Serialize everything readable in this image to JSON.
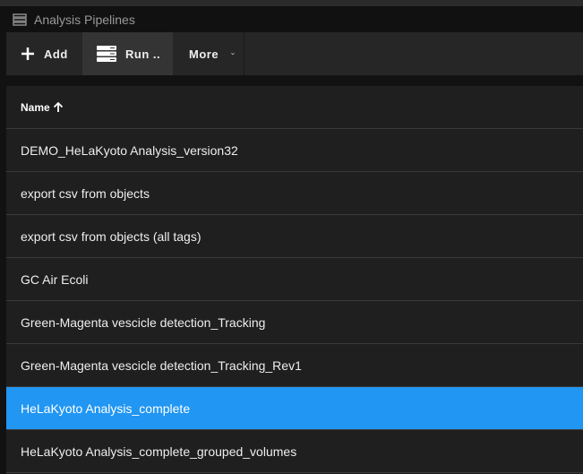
{
  "window": {
    "title": "Analysis Pipelines"
  },
  "toolbar": {
    "add_label": "Add",
    "run_label": "Run ..",
    "more_label": "More"
  },
  "table": {
    "header": {
      "name": "Name",
      "sort": "ascending"
    },
    "rows": [
      {
        "name": "DEMO_HeLaKyoto Analysis_version32",
        "selected": false
      },
      {
        "name": "export csv from objects",
        "selected": false
      },
      {
        "name": "export csv from objects (all tags)",
        "selected": false
      },
      {
        "name": "GC Air Ecoli",
        "selected": false
      },
      {
        "name": "Green-Magenta vescicle detection_Tracking",
        "selected": false
      },
      {
        "name": "Green-Magenta vescicle detection_Tracking_Rev1",
        "selected": false
      },
      {
        "name": "HeLaKyoto Analysis_complete",
        "selected": true
      },
      {
        "name": "HeLaKyoto Analysis_complete_grouped_volumes",
        "selected": false
      }
    ]
  },
  "colors": {
    "accent": "#2196f3",
    "background": "#1f1f1f"
  }
}
